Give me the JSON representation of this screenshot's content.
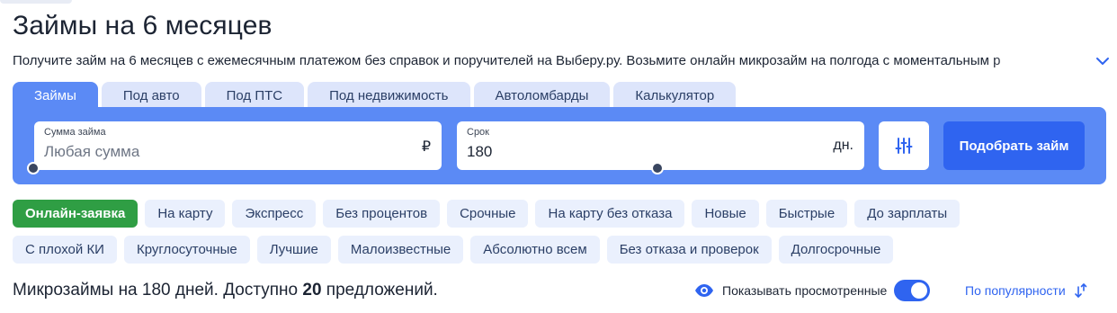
{
  "page": {
    "title": "Займы на 6 месяцев",
    "subtitle": "Получите займ на 6 месяцев с ежемесячным платежом без справок и поручителей на Выберу.ру. Возьмите онлайн микрозайм на полгода с моментальным р"
  },
  "tabs": [
    {
      "label": "Займы",
      "active": true
    },
    {
      "label": "Под авто",
      "active": false
    },
    {
      "label": "Под ПТС",
      "active": false
    },
    {
      "label": "Под недвижимость",
      "active": false
    },
    {
      "label": "Автоломбарды",
      "active": false
    },
    {
      "label": "Калькулятор",
      "active": false
    }
  ],
  "search": {
    "amount": {
      "label": "Сумма займа",
      "placeholder": "Любая сумма",
      "suffix": "₽"
    },
    "term": {
      "label": "Срок",
      "value": "180",
      "suffix": "дн."
    },
    "filter_icon": "sliders-icon",
    "submit_label": "Подобрать займ"
  },
  "chips_row1": [
    {
      "label": "Онлайн-заявка",
      "active": true
    },
    {
      "label": "На карту",
      "active": false
    },
    {
      "label": "Экспресс",
      "active": false
    },
    {
      "label": "Без процентов",
      "active": false
    },
    {
      "label": "Срочные",
      "active": false
    },
    {
      "label": "На карту без отказа",
      "active": false
    },
    {
      "label": "Новые",
      "active": false
    },
    {
      "label": "Быстрые",
      "active": false
    },
    {
      "label": "До зарплаты",
      "active": false
    }
  ],
  "chips_row2": [
    {
      "label": "С плохой КИ",
      "active": false
    },
    {
      "label": "Круглосуточные",
      "active": false
    },
    {
      "label": "Лучшие",
      "active": false
    },
    {
      "label": "Малоизвестные",
      "active": false
    },
    {
      "label": "Абсолютно всем",
      "active": false
    },
    {
      "label": "Без отказа и проверок",
      "active": false
    },
    {
      "label": "Долгосрочные",
      "active": false
    }
  ],
  "results": {
    "prefix": "Микрозаймы на 180 дней. Доступно ",
    "count": "20",
    "suffix": " предложений."
  },
  "viewed_toggle": {
    "label": "Показывать просмотренные",
    "on": true
  },
  "sort": {
    "label": "По популярности"
  },
  "colors": {
    "accent": "#2f64f0",
    "panel": "#5b8af5",
    "chip_bg": "#eaf0fd",
    "chip_active": "#2f9e44",
    "tab_bg": "#dde5fb"
  }
}
